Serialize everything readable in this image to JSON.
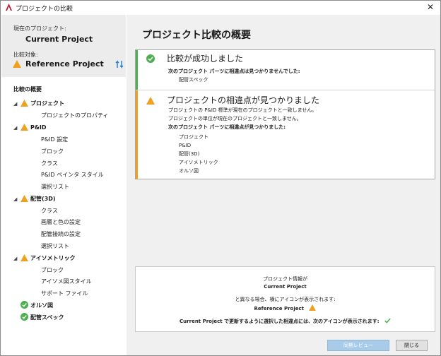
{
  "window": {
    "title": "プロジェクトの比較",
    "close_glyph": "✕"
  },
  "sidebar": {
    "current_label": "現在のプロジェクト:",
    "current_value": "Current Project",
    "compare_label": "比較対象:",
    "compare_value": "Reference Project",
    "summary_label": "比較の概要",
    "tree": [
      {
        "label": "プロジェクト",
        "level": 0,
        "icon": "warning-icon",
        "expanded": true
      },
      {
        "label": "プロジェクトのプロパティ",
        "level": 1
      },
      {
        "label": "P&ID",
        "level": 0,
        "icon": "warning-icon",
        "expanded": true
      },
      {
        "label": "P&ID 設定",
        "level": 1
      },
      {
        "label": "ブロック",
        "level": 1
      },
      {
        "label": "クラス",
        "level": 1
      },
      {
        "label": "P&ID ペインタ スタイル",
        "level": 1
      },
      {
        "label": "選択リスト",
        "level": 1
      },
      {
        "label": "配管(3D)",
        "level": 0,
        "icon": "warning-icon",
        "expanded": true
      },
      {
        "label": "クラス",
        "level": 1
      },
      {
        "label": "画層と色の設定",
        "level": 1
      },
      {
        "label": "配管接続の設定",
        "level": 1
      },
      {
        "label": "選択リスト",
        "level": 1
      },
      {
        "label": "アイソメトリック",
        "level": 0,
        "icon": "warning-icon",
        "expanded": true
      },
      {
        "label": "ブロック",
        "level": 1
      },
      {
        "label": "アイソメ図スタイル",
        "level": 1
      },
      {
        "label": "サポート ファイル",
        "level": 1
      },
      {
        "label": "オルソ図",
        "level": 0,
        "icon": "check-icon"
      },
      {
        "label": "配管スペック",
        "level": 0,
        "icon": "check-icon"
      }
    ]
  },
  "main": {
    "title": "プロジェクト比較の概要",
    "success": {
      "header": "比較が成功しました",
      "line1": "次のプロジェクト パーツに相違点は見つかりませんでした:",
      "items": [
        "配管スペック"
      ]
    },
    "warning": {
      "header": "プロジェクトの相違点が見つかりました",
      "line1": "プロジェクトの P&ID 標準が現在のプロジェクトと一致しません。",
      "line2": "プロジェクトの単位が現在のプロジェクトと一致しません。",
      "line3": "次のプロジェクト パーツに相違点が見つかりました:",
      "items": [
        "プロジェクト",
        "P&ID",
        "配管(3D)",
        "アイソメトリック",
        "オルソ図"
      ]
    },
    "legend": {
      "l1": "プロジェクト情報が",
      "l2": "Current Project",
      "l3": "と異なる場合、横にアイコンが表示されます:",
      "l4": "Reference Project",
      "l5": "Current Project で更新するように選択した相違点には、次のアイコンが表示されます:"
    }
  },
  "buttons": {
    "sync_review": "同期レビュー",
    "close": "閉じる"
  },
  "colors": {
    "warning": "#f0a020",
    "success": "#4caf50",
    "accent_blue": "#a7cbe8"
  }
}
